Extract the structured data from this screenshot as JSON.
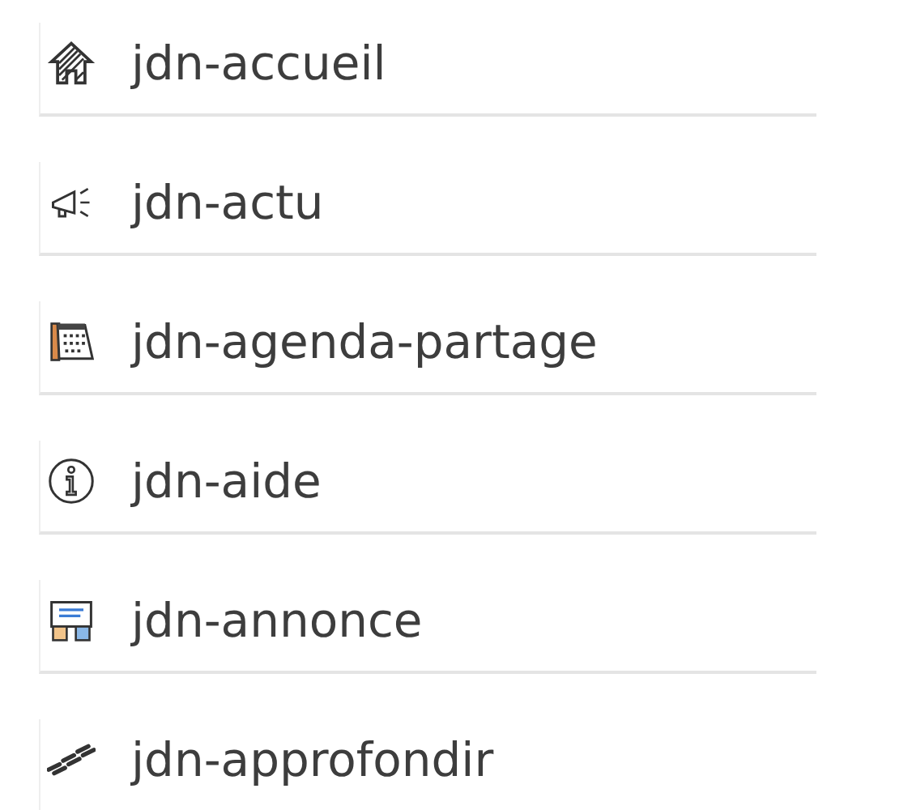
{
  "items": [
    {
      "kind": "home",
      "label": "jdn-accueil"
    },
    {
      "kind": "megaphone",
      "label": "jdn-actu"
    },
    {
      "kind": "calendar",
      "label": "jdn-agenda-partage"
    },
    {
      "kind": "info",
      "label": "jdn-aide"
    },
    {
      "kind": "notice",
      "label": "jdn-annonce"
    },
    {
      "kind": "steps",
      "label": "jdn-approfondir"
    }
  ]
}
